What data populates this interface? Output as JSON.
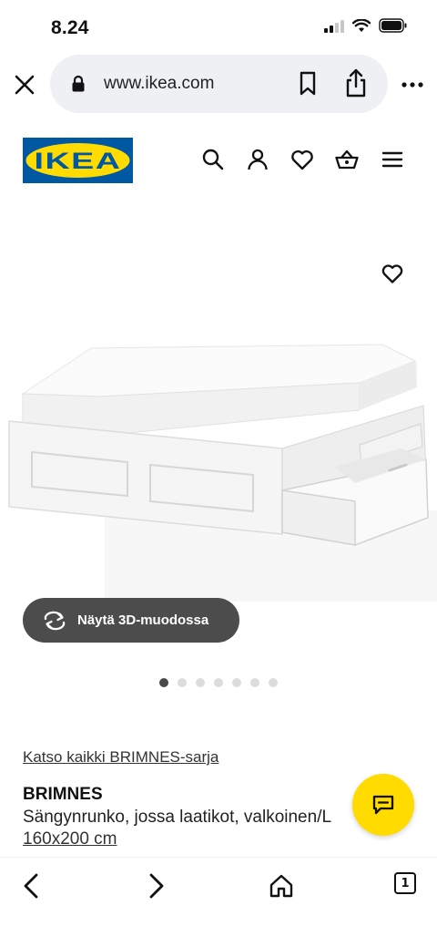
{
  "status_bar": {
    "time": "8.24"
  },
  "browser": {
    "url": "www.ikea.com"
  },
  "header": {
    "logo_text": "IKEA",
    "logo_colors": {
      "blue": "#0058a3",
      "yellow": "#ffdb00"
    }
  },
  "product": {
    "view_3d_label": "Näytä 3D-muodossa",
    "image_count": 7,
    "active_image": 1,
    "series_link": "Katso kaikki BRIMNES-sarja",
    "name": "BRIMNES",
    "description": "Sängynrunko, jossa laatikot, valkoinen/L",
    "size": "160x200 cm"
  },
  "chat": {
    "accent": "#ffdb00",
    "icon": "chat-icon"
  },
  "bottom_bar": {
    "tab_count": "1"
  }
}
